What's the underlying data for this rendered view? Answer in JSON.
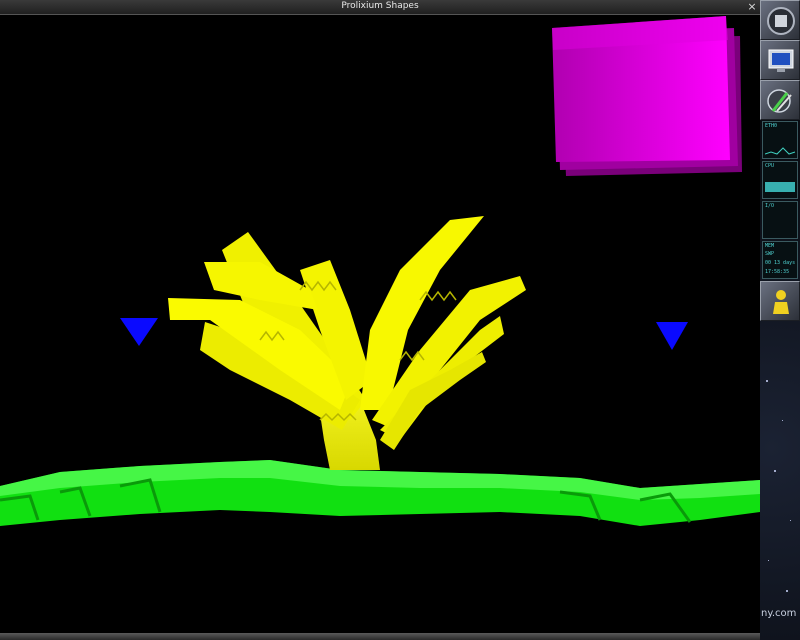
{
  "window": {
    "title": "Prolixium Shapes",
    "close_glyph": "×"
  },
  "scene": {
    "background": "#000000",
    "shapes": [
      {
        "name": "yellow-fern",
        "color": "#ffff00"
      },
      {
        "name": "green-ribbon",
        "color": "#00ff00"
      },
      {
        "name": "magenta-panel",
        "color": "#ff00ff"
      },
      {
        "name": "blue-triangle-left",
        "color": "#0000ff"
      },
      {
        "name": "blue-triangle-right",
        "color": "#0000ff"
      }
    ]
  },
  "dock": {
    "tiles": [
      {
        "icon": "dock-app-icon"
      },
      {
        "icon": "monitor-icon"
      },
      {
        "icon": "wrench-icon"
      }
    ],
    "eth_label": "ETH0",
    "cpu_label": "CPU",
    "io_label": "I/O",
    "mem_label": "MEM",
    "swp_label": "SWP",
    "uptime_label": "00 13 days",
    "clock": "17:58:35",
    "watermark": "ny.com"
  }
}
